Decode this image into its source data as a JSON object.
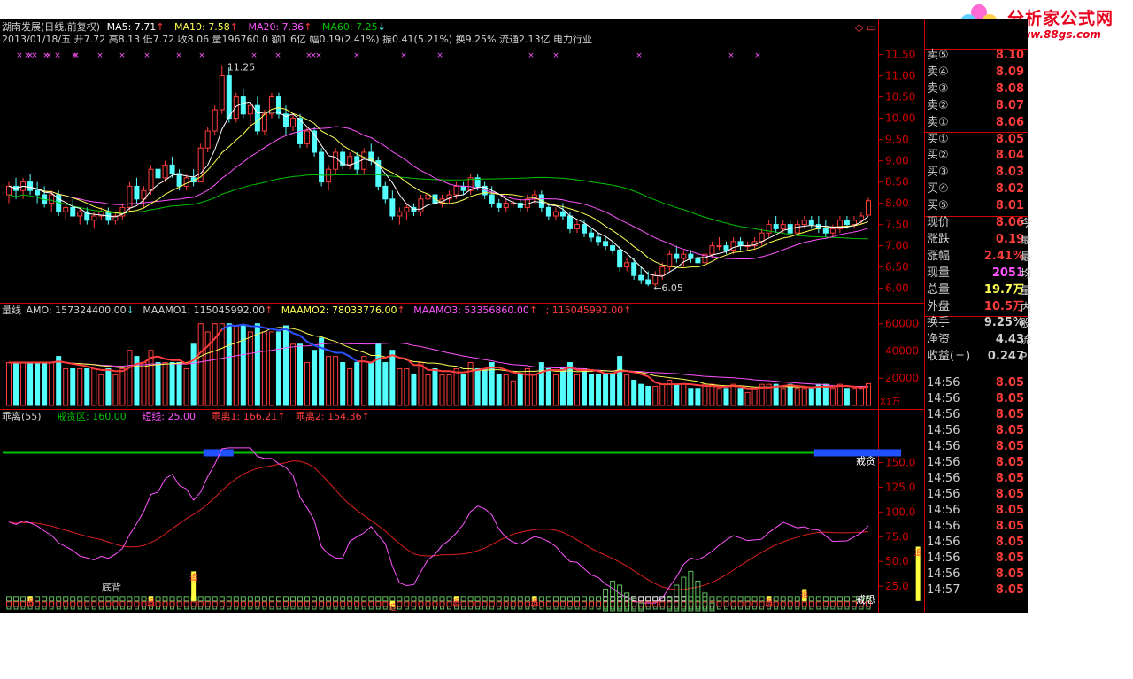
{
  "title_bar": {
    "stock": "湖南发展(日线,前复权)",
    "ma5": "MA5: 7.71",
    "ma10": "MA10: 7.58",
    "ma20": "MA20: 7.36",
    "ma60": "MA60: 7.25",
    "quote": "2013/01/18/五 开7.72 高8.13 低7.72 收8.06 量196760.0 额1.6亿 幅0.19(2.41%) 振0.41(5.21%) 换9.25% 流通2.13亿 电力行业",
    "corner_icons": "◇ ▭"
  },
  "volume_header": {
    "name": "量线",
    "amo": "AMO: 157324400.00",
    "maamo1": "MAAMO1: 115045992.00",
    "maamo2": "MAAMO2: 78033776.00",
    "maamo3": "MAAMO3: 53356860.00",
    "extra": "; 115045992.00"
  },
  "osc_header": {
    "name": "乖离(55)",
    "zone": "戒贪区: 160.00",
    "short": "短线: 25.00",
    "dev1": "乖离1: 166.21",
    "dev2": "乖离2: 154.36"
  },
  "annotations": {
    "high_label": "11.25",
    "low_label": "6.05",
    "bottom_div": "底背",
    "greed": "戒贪",
    "fear": "戒恐",
    "vol_unit": "X1万",
    "mark_char": "追"
  },
  "order_book": {
    "sell": [
      {
        "label": "卖⑤",
        "price": "8.10"
      },
      {
        "label": "卖④",
        "price": "8.09"
      },
      {
        "label": "卖③",
        "price": "8.08"
      },
      {
        "label": "卖②",
        "price": "8.07"
      },
      {
        "label": "卖①",
        "price": "8.06"
      }
    ],
    "buy": [
      {
        "label": "买①",
        "price": "8.05"
      },
      {
        "label": "买②",
        "price": "8.04"
      },
      {
        "label": "买③",
        "price": "8.03"
      },
      {
        "label": "买④",
        "price": "8.02"
      },
      {
        "label": "买⑤",
        "price": "8.01"
      }
    ]
  },
  "quote_stats": [
    {
      "label": "现价",
      "value": "8.06",
      "cut": "今"
    },
    {
      "label": "涨跌",
      "value": "0.19",
      "cut": "最"
    },
    {
      "label": "涨幅",
      "value": "2.41%",
      "cut": "最"
    },
    {
      "label": "现量",
      "value": "2051",
      "cut": "均"
    },
    {
      "label": "总量",
      "value": "19.7万",
      "cut": "量"
    },
    {
      "label": "外盘",
      "value": "10.5万",
      "cut": "内"
    },
    {
      "label": "换手",
      "value": "9.25%",
      "cut": "股"
    },
    {
      "label": "净资",
      "value": "4.43",
      "cut": "流"
    },
    {
      "label": "收益(三)",
      "value": "0.247",
      "cut": "P"
    }
  ],
  "ticks": [
    {
      "time": "14:56",
      "price": "8.05"
    },
    {
      "time": "14:56",
      "price": "8.05"
    },
    {
      "time": "14:56",
      "price": "8.05"
    },
    {
      "time": "14:56",
      "price": "8.05"
    },
    {
      "time": "14:56",
      "price": "8.05"
    },
    {
      "time": "14:56",
      "price": "8.05"
    },
    {
      "time": "14:56",
      "price": "8.05"
    },
    {
      "time": "14:56",
      "price": "8.05"
    },
    {
      "time": "14:56",
      "price": "8.05"
    },
    {
      "time": "14:56",
      "price": "8.05"
    },
    {
      "time": "14:56",
      "price": "8.05"
    },
    {
      "time": "14:56",
      "price": "8.05"
    },
    {
      "time": "14:56",
      "price": "8.05"
    },
    {
      "time": "14:57",
      "price": "8.05"
    }
  ],
  "logo": {
    "brand": "分析家公式网",
    "url": "www.88gs.com"
  },
  "colors": {
    "up": "#ff3c3c",
    "down": "#54ffff",
    "ma5": "#ffffff",
    "ma10": "#ffff54",
    "ma20": "#ff54ff",
    "ma60": "#00c000",
    "axis": "#d00000",
    "grid": "#600000",
    "blue": "#2050ff",
    "green": "#00c000",
    "yellow": "#ffff40"
  },
  "chart_data": [
    {
      "type": "candlestick",
      "title": "湖南发展(日线,前复权)",
      "ylim": [
        5.7,
        11.7
      ],
      "yticks": [
        6.0,
        6.5,
        7.0,
        7.5,
        8.0,
        8.5,
        9.0,
        9.5,
        10.0,
        10.5,
        11.0,
        11.5
      ],
      "ohlc": [
        [
          8.2,
          8.5,
          8.0,
          8.4
        ],
        [
          8.4,
          8.6,
          8.1,
          8.3
        ],
        [
          8.3,
          8.6,
          8.1,
          8.5
        ],
        [
          8.5,
          8.7,
          8.2,
          8.3
        ],
        [
          8.3,
          8.5,
          8.0,
          8.2
        ],
        [
          8.2,
          8.4,
          7.9,
          8.0
        ],
        [
          8.0,
          8.3,
          7.8,
          8.2
        ],
        [
          8.2,
          8.3,
          7.7,
          7.8
        ],
        [
          7.8,
          8.0,
          7.6,
          7.9
        ],
        [
          7.9,
          8.1,
          7.7,
          7.7
        ],
        [
          7.7,
          7.9,
          7.5,
          7.8
        ],
        [
          7.8,
          7.9,
          7.5,
          7.6
        ],
        [
          7.6,
          7.8,
          7.4,
          7.7
        ],
        [
          7.7,
          7.9,
          7.6,
          7.8
        ],
        [
          7.8,
          7.9,
          7.5,
          7.6
        ],
        [
          7.6,
          7.8,
          7.5,
          7.7
        ],
        [
          7.7,
          8.0,
          7.6,
          7.9
        ],
        [
          7.9,
          8.5,
          7.8,
          8.4
        ],
        [
          8.4,
          8.6,
          8.0,
          8.1
        ],
        [
          8.1,
          8.4,
          7.9,
          8.3
        ],
        [
          8.3,
          8.9,
          8.2,
          8.8
        ],
        [
          8.8,
          9.0,
          8.5,
          8.6
        ],
        [
          8.6,
          9.0,
          8.5,
          8.9
        ],
        [
          8.9,
          9.1,
          8.6,
          8.7
        ],
        [
          8.7,
          8.8,
          8.3,
          8.4
        ],
        [
          8.4,
          8.7,
          8.3,
          8.6
        ],
        [
          8.6,
          8.8,
          8.4,
          8.5
        ],
        [
          8.5,
          9.4,
          8.5,
          9.3
        ],
        [
          9.3,
          9.8,
          9.2,
          9.7
        ],
        [
          9.7,
          10.3,
          9.6,
          10.2
        ],
        [
          10.2,
          11.25,
          10.1,
          11.0
        ],
        [
          11.0,
          11.2,
          9.9,
          10.0
        ],
        [
          10.0,
          10.6,
          9.9,
          10.5
        ],
        [
          10.5,
          10.7,
          10.0,
          10.1
        ],
        [
          10.1,
          10.4,
          9.8,
          10.3
        ],
        [
          10.3,
          10.5,
          9.6,
          9.7
        ],
        [
          9.7,
          10.2,
          9.6,
          10.1
        ],
        [
          10.1,
          10.6,
          10.0,
          10.5
        ],
        [
          10.5,
          10.6,
          10.0,
          10.1
        ],
        [
          10.1,
          10.3,
          9.6,
          9.8
        ],
        [
          9.8,
          10.1,
          9.7,
          10.0
        ],
        [
          10.0,
          10.1,
          9.3,
          9.4
        ],
        [
          9.4,
          9.8,
          9.3,
          9.7
        ],
        [
          9.7,
          9.8,
          9.1,
          9.2
        ],
        [
          9.2,
          9.3,
          8.4,
          8.5
        ],
        [
          8.5,
          8.9,
          8.3,
          8.8
        ],
        [
          8.8,
          9.3,
          8.7,
          9.2
        ],
        [
          9.2,
          9.3,
          8.8,
          8.9
        ],
        [
          8.9,
          9.2,
          8.8,
          9.1
        ],
        [
          9.1,
          9.2,
          8.7,
          8.8
        ],
        [
          8.8,
          9.3,
          8.7,
          9.2
        ],
        [
          9.2,
          9.4,
          8.9,
          9.0
        ],
        [
          9.0,
          9.1,
          8.3,
          8.4
        ],
        [
          8.4,
          8.5,
          8.0,
          8.1
        ],
        [
          8.1,
          8.3,
          7.6,
          7.7
        ],
        [
          7.7,
          7.9,
          7.5,
          7.8
        ],
        [
          7.8,
          8.0,
          7.6,
          7.9
        ],
        [
          7.9,
          8.0,
          7.7,
          7.8
        ],
        [
          7.8,
          8.2,
          7.7,
          8.1
        ],
        [
          8.1,
          8.3,
          8.0,
          8.2
        ],
        [
          8.2,
          8.3,
          7.9,
          8.0
        ],
        [
          8.0,
          8.2,
          7.9,
          8.1
        ],
        [
          8.1,
          8.3,
          8.0,
          8.2
        ],
        [
          8.2,
          8.5,
          8.1,
          8.4
        ],
        [
          8.4,
          8.5,
          8.2,
          8.3
        ],
        [
          8.3,
          8.7,
          8.2,
          8.6
        ],
        [
          8.6,
          8.7,
          8.3,
          8.4
        ],
        [
          8.4,
          8.5,
          8.1,
          8.2
        ],
        [
          8.2,
          8.4,
          7.9,
          8.0
        ],
        [
          8.0,
          8.1,
          7.8,
          7.9
        ],
        [
          7.9,
          8.1,
          7.8,
          8.0
        ],
        [
          8.0,
          8.1,
          7.9,
          8.0
        ],
        [
          8.0,
          8.1,
          7.8,
          7.9
        ],
        [
          7.9,
          8.2,
          7.8,
          8.1
        ],
        [
          8.1,
          8.3,
          8.0,
          8.2
        ],
        [
          8.2,
          8.3,
          7.8,
          7.9
        ],
        [
          7.9,
          8.0,
          7.6,
          7.7
        ],
        [
          7.7,
          7.9,
          7.6,
          7.8
        ],
        [
          7.8,
          8.0,
          7.6,
          7.7
        ],
        [
          7.7,
          7.8,
          7.3,
          7.4
        ],
        [
          7.4,
          7.6,
          7.3,
          7.5
        ],
        [
          7.5,
          7.6,
          7.2,
          7.3
        ],
        [
          7.3,
          7.4,
          7.1,
          7.2
        ],
        [
          7.2,
          7.3,
          7.0,
          7.1
        ],
        [
          7.1,
          7.2,
          6.9,
          7.0
        ],
        [
          7.0,
          7.1,
          6.8,
          6.9
        ],
        [
          6.9,
          7.0,
          6.4,
          6.5
        ],
        [
          6.5,
          6.7,
          6.4,
          6.6
        ],
        [
          6.6,
          6.7,
          6.2,
          6.3
        ],
        [
          6.3,
          6.5,
          6.1,
          6.2
        ],
        [
          6.2,
          6.4,
          6.05,
          6.1
        ],
        [
          6.1,
          6.4,
          6.05,
          6.3
        ],
        [
          6.3,
          6.6,
          6.2,
          6.5
        ],
        [
          6.5,
          6.9,
          6.4,
          6.8
        ],
        [
          6.8,
          7.0,
          6.6,
          6.7
        ],
        [
          6.7,
          6.9,
          6.5,
          6.8
        ],
        [
          6.8,
          6.9,
          6.6,
          6.7
        ],
        [
          6.7,
          6.8,
          6.5,
          6.6
        ],
        [
          6.6,
          6.9,
          6.5,
          6.8
        ],
        [
          6.8,
          7.1,
          6.7,
          7.0
        ],
        [
          7.0,
          7.2,
          6.9,
          7.0
        ],
        [
          7.0,
          7.1,
          6.8,
          6.9
        ],
        [
          6.9,
          7.2,
          6.8,
          7.1
        ],
        [
          7.1,
          7.2,
          6.9,
          7.0
        ],
        [
          7.0,
          7.1,
          6.9,
          7.0
        ],
        [
          7.0,
          7.2,
          6.9,
          7.1
        ],
        [
          7.1,
          7.4,
          7.0,
          7.3
        ],
        [
          7.3,
          7.6,
          7.2,
          7.5
        ],
        [
          7.5,
          7.7,
          7.3,
          7.4
        ],
        [
          7.4,
          7.6,
          7.3,
          7.5
        ],
        [
          7.5,
          7.6,
          7.2,
          7.3
        ],
        [
          7.3,
          7.6,
          7.3,
          7.5
        ],
        [
          7.5,
          7.7,
          7.4,
          7.6
        ],
        [
          7.6,
          7.7,
          7.4,
          7.5
        ],
        [
          7.5,
          7.7,
          7.3,
          7.4
        ],
        [
          7.4,
          7.6,
          7.2,
          7.3
        ],
        [
          7.3,
          7.5,
          7.2,
          7.4
        ],
        [
          7.4,
          7.7,
          7.3,
          7.6
        ],
        [
          7.6,
          7.7,
          7.4,
          7.5
        ],
        [
          7.5,
          7.7,
          7.4,
          7.6
        ],
        [
          7.6,
          7.8,
          7.5,
          7.7
        ],
        [
          7.72,
          8.13,
          7.72,
          8.06
        ]
      ],
      "series_names": [
        "MA5",
        "MA10",
        "MA20",
        "MA60"
      ]
    },
    {
      "type": "bar",
      "title": "量线",
      "unit": "X1万",
      "ylim": [
        0,
        65000
      ],
      "yticks": [
        20000,
        40000,
        60000
      ],
      "series_names": [
        "AMO",
        "MAAMO1",
        "MAAMO2",
        "MAAMO3"
      ]
    },
    {
      "type": "line",
      "title": "乖离(55)",
      "ylim": [
        0,
        190
      ],
      "yticks": [
        25,
        50,
        75,
        100,
        125,
        150
      ],
      "threshold": 160,
      "series": [
        {
          "name": "乖离1",
          "last": 166.21
        },
        {
          "name": "乖离2",
          "last": 154.36
        }
      ]
    }
  ]
}
